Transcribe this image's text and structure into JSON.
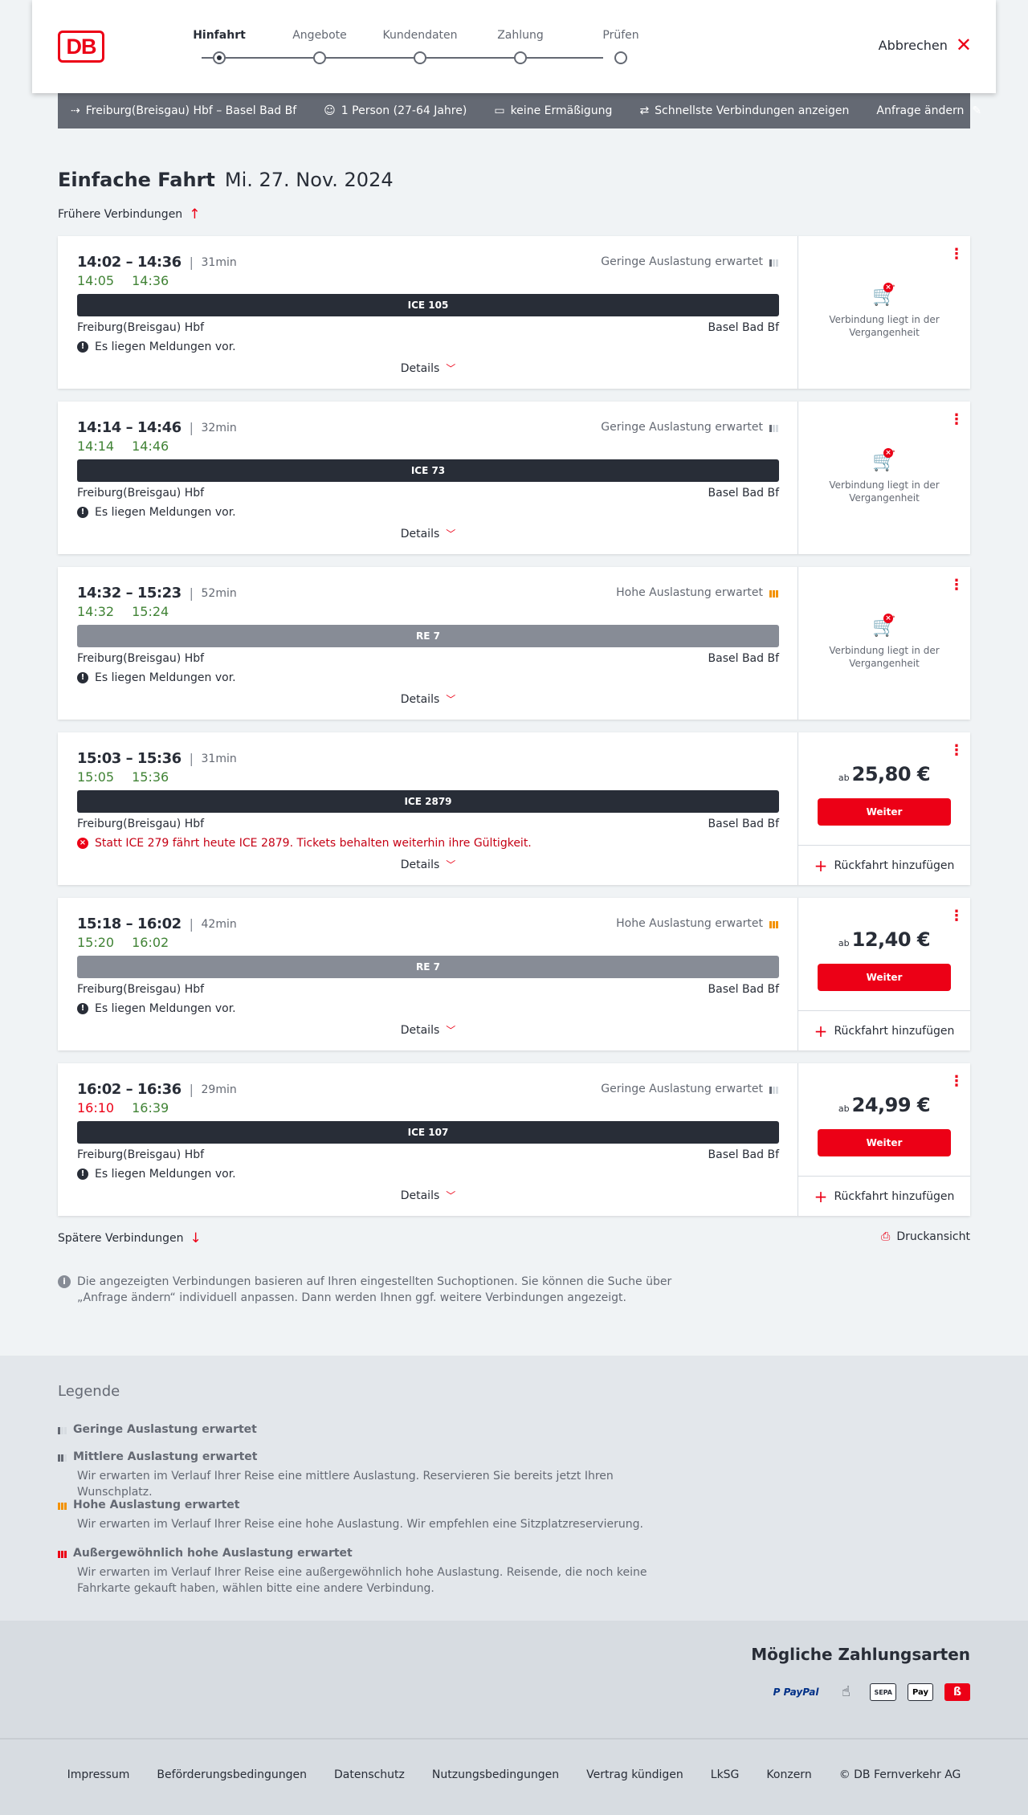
{
  "header": {
    "logo": "DB",
    "steps": [
      {
        "label": "Hinfahrt",
        "active": true
      },
      {
        "label": "Angebote",
        "active": false
      },
      {
        "label": "Kundendaten",
        "active": false
      },
      {
        "label": "Zahlung",
        "active": false
      },
      {
        "label": "Prüfen",
        "active": false
      }
    ],
    "cancel_label": "Abbrechen"
  },
  "request": {
    "route": "Freiburg(Breisgau) Hbf – Basel Bad Bf",
    "travellers": "1 Person (27-64 Jahre)",
    "discount": "keine Ermäßigung",
    "fastest": "Schnellste Verbindungen anzeigen",
    "change": "Anfrage ändern"
  },
  "page": {
    "title": "Einfache Fahrt",
    "date": "Mi. 27. Nov. 2024",
    "earlier": "Frühere Verbindungen",
    "later": "Spätere Verbindungen",
    "print": "Druckansicht",
    "note": "Die angezeigten Verbindungen basieren auf Ihren eingestellten Suchoptionen. Sie können die Suche über „Anfrage ändern“ individuell anpassen. Dann werden Ihnen ggf. weitere Verbindungen angezeigt."
  },
  "labels": {
    "details": "Details",
    "past": "Verbindung liegt in der Vergangenheit",
    "ab": "ab",
    "weiter": "Weiter",
    "return": "Rückfahrt hinzufügen"
  },
  "connections": [
    {
      "times": "14:02 – 14:36",
      "duration": "31min",
      "occupancy": "Geringe Auslastung erwartet",
      "occ_level": "low",
      "rt_dep": "14:05",
      "rt_dep_late": false,
      "rt_arr": "14:36",
      "train": "ICE 105",
      "train_type": "ice",
      "from": "Freiburg(Breisgau) Hbf",
      "to": "Basel Bad Bf",
      "message": "Es liegen Meldungen vor.",
      "message_type": "info",
      "status": "past",
      "price": ""
    },
    {
      "times": "14:14 – 14:46",
      "duration": "32min",
      "occupancy": "Geringe Auslastung erwartet",
      "occ_level": "low",
      "rt_dep": "14:14",
      "rt_dep_late": false,
      "rt_arr": "14:46",
      "train": "ICE 73",
      "train_type": "ice",
      "from": "Freiburg(Breisgau) Hbf",
      "to": "Basel Bad Bf",
      "message": "Es liegen Meldungen vor.",
      "message_type": "info",
      "status": "past",
      "price": ""
    },
    {
      "times": "14:32 – 15:23",
      "duration": "52min",
      "occupancy": "Hohe Auslastung erwartet",
      "occ_level": "high",
      "rt_dep": "14:32",
      "rt_dep_late": false,
      "rt_arr": "15:24",
      "train": "RE 7",
      "train_type": "re",
      "from": "Freiburg(Breisgau) Hbf",
      "to": "Basel Bad Bf",
      "message": "Es liegen Meldungen vor.",
      "message_type": "info",
      "status": "past",
      "price": ""
    },
    {
      "times": "15:03 – 15:36",
      "duration": "31min",
      "occupancy": "",
      "occ_level": "none",
      "rt_dep": "15:05",
      "rt_dep_late": false,
      "rt_arr": "15:36",
      "train": "ICE 2879",
      "train_type": "ice",
      "from": "Freiburg(Breisgau) Hbf",
      "to": "Basel Bad Bf",
      "message": "Statt ICE 279 fährt heute ICE 2879. Tickets behalten weiterhin ihre Gültigkeit.",
      "message_type": "warn",
      "status": "bookable",
      "price": "25,80 €"
    },
    {
      "times": "15:18 – 16:02",
      "duration": "42min",
      "occupancy": "Hohe Auslastung erwartet",
      "occ_level": "high",
      "rt_dep": "15:20",
      "rt_dep_late": false,
      "rt_arr": "16:02",
      "train": "RE 7",
      "train_type": "re",
      "from": "Freiburg(Breisgau) Hbf",
      "to": "Basel Bad Bf",
      "message": "Es liegen Meldungen vor.",
      "message_type": "info",
      "status": "bookable",
      "price": "12,40 €"
    },
    {
      "times": "16:02 – 16:36",
      "duration": "29min",
      "occupancy": "Geringe Auslastung erwartet",
      "occ_level": "low",
      "rt_dep": "16:10",
      "rt_dep_late": true,
      "rt_arr": "16:39",
      "train": "ICE 107",
      "train_type": "ice",
      "from": "Freiburg(Breisgau) Hbf",
      "to": "Basel Bad Bf",
      "message": "Es liegen Meldungen vor.",
      "message_type": "info",
      "status": "bookable",
      "price": "24,99 €"
    }
  ],
  "legend": {
    "title": "Legende",
    "items": [
      {
        "level": "low",
        "title": "Geringe Auslastung erwartet",
        "desc": ""
      },
      {
        "level": "medium",
        "title": "Mittlere Auslastung erwartet",
        "desc": "Wir erwarten im Verlauf Ihrer Reise eine mittlere Auslastung. Reservieren Sie bereits jetzt Ihren Wunschplatz."
      },
      {
        "level": "high",
        "title": "Hohe Auslastung erwartet",
        "desc": "Wir erwarten im Verlauf Ihrer Reise eine hohe Auslastung. Wir empfehlen eine Sitzplatzreservierung."
      },
      {
        "level": "very",
        "title": "Außergewöhnlich hohe Auslastung erwartet",
        "desc": "Wir erwarten im Verlauf Ihrer Reise eine außergewöhnlich hohe Auslastung. Reisende, die noch keine Fahrkarte gekauft haben, wählen bitte eine andere Verbindung."
      }
    ]
  },
  "payment": {
    "title": "Mögliche Zahlungsarten",
    "methods": [
      {
        "icon": "paypal-icon",
        "label": "P PayPal",
        "cls": "paypal"
      },
      {
        "icon": "invoice-hand-icon",
        "label": "☝",
        "cls": "hand"
      },
      {
        "icon": "sepa-icon",
        "label": "SEPA",
        "cls": "sepa"
      },
      {
        "icon": "apple-pay-icon",
        "label": " Pay",
        "cls": "apple"
      },
      {
        "icon": "db-card-icon",
        "label": "ß",
        "cls": "db"
      }
    ]
  },
  "footer": {
    "links": [
      "Impressum",
      "Beförderungsbedingungen",
      "Datenschutz",
      "Nutzungsbedingungen",
      "Vertrag kündigen",
      "LkSG",
      "Konzern",
      "© DB Fernverkehr AG"
    ]
  },
  "colors": {
    "brand_red": "#ec0016",
    "realtime_green": "#408335",
    "infobar_gray": "#646973",
    "high_orange": "#f39200"
  }
}
